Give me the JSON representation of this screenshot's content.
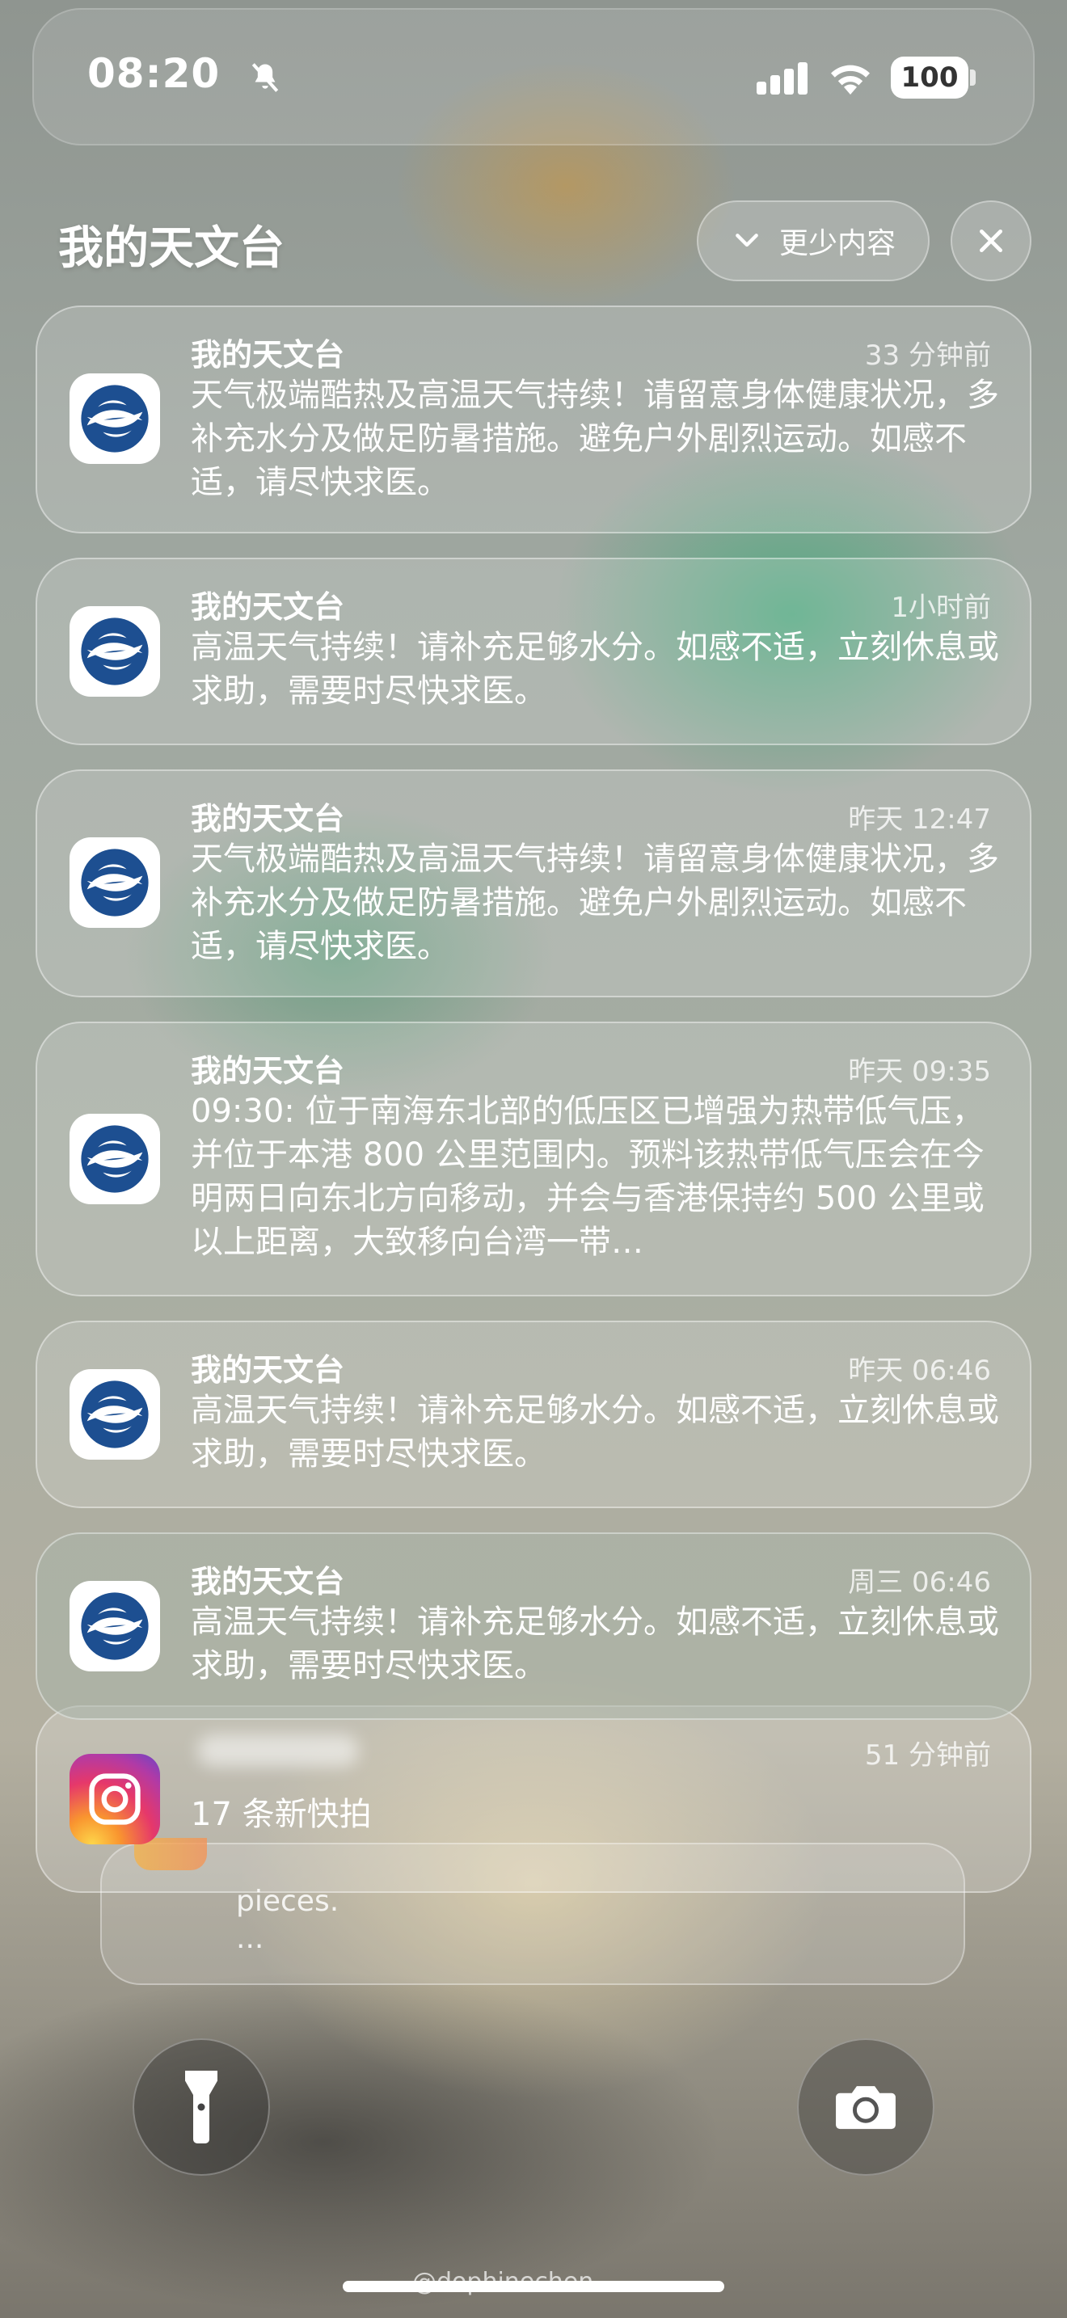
{
  "status_bar": {
    "time": "08:20",
    "battery": "100",
    "icons": [
      "bell-slash-icon",
      "cellular-signal-icon",
      "wifi-icon",
      "battery-icon"
    ]
  },
  "group": {
    "title": "我的天文台",
    "show_less_label": "更少内容"
  },
  "notifications": [
    {
      "app": "我的天文台",
      "time": "33 分钟前",
      "body": "天气极端酷热及高温天气持续！请留意身体健康状况，多补充水分及做足防暑措施。避免户外剧烈运动。如感不适，请尽快求医。"
    },
    {
      "app": "我的天文台",
      "time": "1小时前",
      "body": "高温天气持续！请补充足够水分。如感不适，立刻休息或求助，需要时尽快求医。"
    },
    {
      "app": "我的天文台",
      "time": "昨天 12:47",
      "body": "天气极端酷热及高温天气持续！请留意身体健康状况，多补充水分及做足防暑措施。避免户外剧烈运动。如感不适，请尽快求医。"
    },
    {
      "app": "我的天文台",
      "time": "昨天 09:35",
      "body": "09:30: 位于南海东北部的低压区已增强为热带低气压，并位于本港 800 公里范围内。预料该热带低气压会在今明两日向东北方向移动，并会与香港保持约 500 公里或以上距离，大致移向台湾一带…"
    },
    {
      "app": "我的天文台",
      "time": "昨天 06:46",
      "body": "高温天气持续！请补充足够水分。如感不适，立刻休息或求助，需要时尽快求医。"
    },
    {
      "app": "我的天文台",
      "time": "周三 06:46",
      "body": "高温天气持续！请补充足够水分。如感不适，立刻休息或求助，需要时尽快求医。"
    }
  ],
  "instagram": {
    "time": "51 分钟前",
    "body": "17 条新快拍",
    "stacked_preview_line1": "pieces.",
    "stacked_preview_line2": "..."
  },
  "bottom": {
    "watermark": "@dophinechen"
  },
  "colors": {
    "observatory_icon_blue": "#1d4f91",
    "instagram_gradient": [
      "#fdd64a",
      "#e6386a",
      "#6a46c7"
    ]
  }
}
